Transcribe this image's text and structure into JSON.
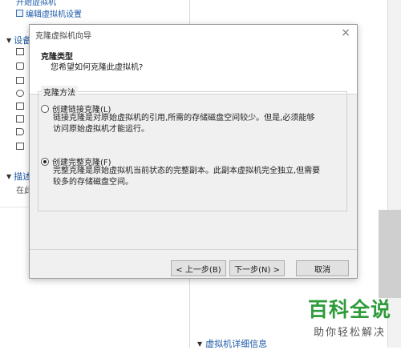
{
  "background": {
    "partial_link": "开始虚拟机",
    "edit_settings": "编辑虚拟机设置",
    "devices_section": "设备",
    "description_section": "描述",
    "description_hint": "在此",
    "vm_details": "虚拟机详细信息"
  },
  "watermark": {
    "main": "百科全说",
    "sub": "助你轻松解决"
  },
  "dialog": {
    "title": "克隆虚拟机向导",
    "header_title": "克隆类型",
    "header_subtitle": "您希望如何克隆此虚拟机?",
    "group_label": "克隆方法",
    "option_linked_label": "创建链接克隆(L)",
    "option_linked_desc": "链接克隆是对原始虚拟机的引用,所需的存储磁盘空间较少。但是,必须能够访问原始虚拟机才能运行。",
    "option_full_label": "创建完整克隆(F)",
    "option_full_desc": "完整克隆是原始虚拟机当前状态的完整副本。此副本虚拟机完全独立,但需要较多的存储磁盘空间。",
    "selected_option": "full",
    "back_button": "< 上一步(B)",
    "next_button": "下一步(N) >",
    "cancel_button": "取消"
  }
}
